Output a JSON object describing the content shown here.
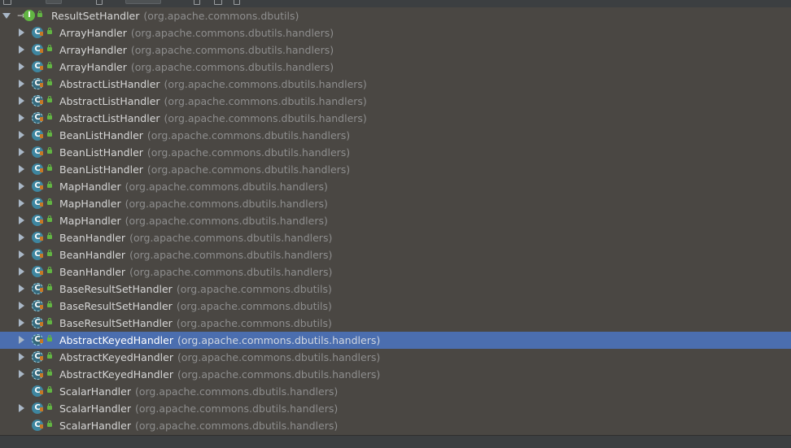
{
  "root": {
    "name": "ResultSetHandler",
    "package": "(org.apache.commons.dbutils)",
    "icon": "interface-icon",
    "expanded": true
  },
  "colors": {
    "tree_background": "#4a4743",
    "selection": "#4b6eaf",
    "class_icon": "#3e86a0",
    "interface_icon": "#62b543",
    "text": "#d6d6d6",
    "package_text": "#8e8e8e"
  },
  "rows": [
    {
      "name": "ArrayHandler",
      "package": "(org.apache.commons.dbutils.handlers)",
      "icon": "class-icon",
      "expandable": true,
      "selected": false
    },
    {
      "name": "ArrayHandler",
      "package": "(org.apache.commons.dbutils.handlers)",
      "icon": "class-icon",
      "expandable": true,
      "selected": false
    },
    {
      "name": "ArrayHandler",
      "package": "(org.apache.commons.dbutils.handlers)",
      "icon": "class-icon",
      "expandable": true,
      "selected": false
    },
    {
      "name": "AbstractListHandler",
      "package": "(org.apache.commons.dbutils.handlers)",
      "icon": "abstract-class-icon",
      "expandable": true,
      "selected": false
    },
    {
      "name": "AbstractListHandler",
      "package": "(org.apache.commons.dbutils.handlers)",
      "icon": "abstract-class-icon",
      "expandable": true,
      "selected": false
    },
    {
      "name": "AbstractListHandler",
      "package": "(org.apache.commons.dbutils.handlers)",
      "icon": "abstract-class-icon",
      "expandable": true,
      "selected": false
    },
    {
      "name": "BeanListHandler",
      "package": "(org.apache.commons.dbutils.handlers)",
      "icon": "class-icon",
      "expandable": true,
      "selected": false
    },
    {
      "name": "BeanListHandler",
      "package": "(org.apache.commons.dbutils.handlers)",
      "icon": "class-icon",
      "expandable": true,
      "selected": false
    },
    {
      "name": "BeanListHandler",
      "package": "(org.apache.commons.dbutils.handlers)",
      "icon": "class-icon",
      "expandable": true,
      "selected": false
    },
    {
      "name": "MapHandler",
      "package": "(org.apache.commons.dbutils.handlers)",
      "icon": "class-icon",
      "expandable": true,
      "selected": false
    },
    {
      "name": "MapHandler",
      "package": "(org.apache.commons.dbutils.handlers)",
      "icon": "class-icon",
      "expandable": true,
      "selected": false
    },
    {
      "name": "MapHandler",
      "package": "(org.apache.commons.dbutils.handlers)",
      "icon": "class-icon",
      "expandable": true,
      "selected": false
    },
    {
      "name": "BeanHandler",
      "package": "(org.apache.commons.dbutils.handlers)",
      "icon": "class-icon",
      "expandable": true,
      "selected": false
    },
    {
      "name": "BeanHandler",
      "package": "(org.apache.commons.dbutils.handlers)",
      "icon": "class-icon",
      "expandable": true,
      "selected": false
    },
    {
      "name": "BeanHandler",
      "package": "(org.apache.commons.dbutils.handlers)",
      "icon": "class-icon",
      "expandable": true,
      "selected": false
    },
    {
      "name": "BaseResultSetHandler",
      "package": "(org.apache.commons.dbutils)",
      "icon": "abstract-class-icon",
      "expandable": true,
      "selected": false
    },
    {
      "name": "BaseResultSetHandler",
      "package": "(org.apache.commons.dbutils)",
      "icon": "abstract-class-icon",
      "expandable": true,
      "selected": false
    },
    {
      "name": "BaseResultSetHandler",
      "package": "(org.apache.commons.dbutils)",
      "icon": "abstract-class-icon",
      "expandable": true,
      "selected": false
    },
    {
      "name": "AbstractKeyedHandler",
      "package": "(org.apache.commons.dbutils.handlers)",
      "icon": "abstract-class-icon",
      "expandable": true,
      "selected": true
    },
    {
      "name": "AbstractKeyedHandler",
      "package": "(org.apache.commons.dbutils.handlers)",
      "icon": "abstract-class-icon",
      "expandable": true,
      "selected": false
    },
    {
      "name": "AbstractKeyedHandler",
      "package": "(org.apache.commons.dbutils.handlers)",
      "icon": "abstract-class-icon",
      "expandable": true,
      "selected": false
    },
    {
      "name": "ScalarHandler",
      "package": "(org.apache.commons.dbutils.handlers)",
      "icon": "class-icon",
      "expandable": false,
      "selected": false
    },
    {
      "name": "ScalarHandler",
      "package": "(org.apache.commons.dbutils.handlers)",
      "icon": "class-icon",
      "expandable": true,
      "selected": false
    },
    {
      "name": "ScalarHandler",
      "package": "(org.apache.commons.dbutils.handlers)",
      "icon": "class-icon",
      "expandable": false,
      "selected": false
    }
  ]
}
